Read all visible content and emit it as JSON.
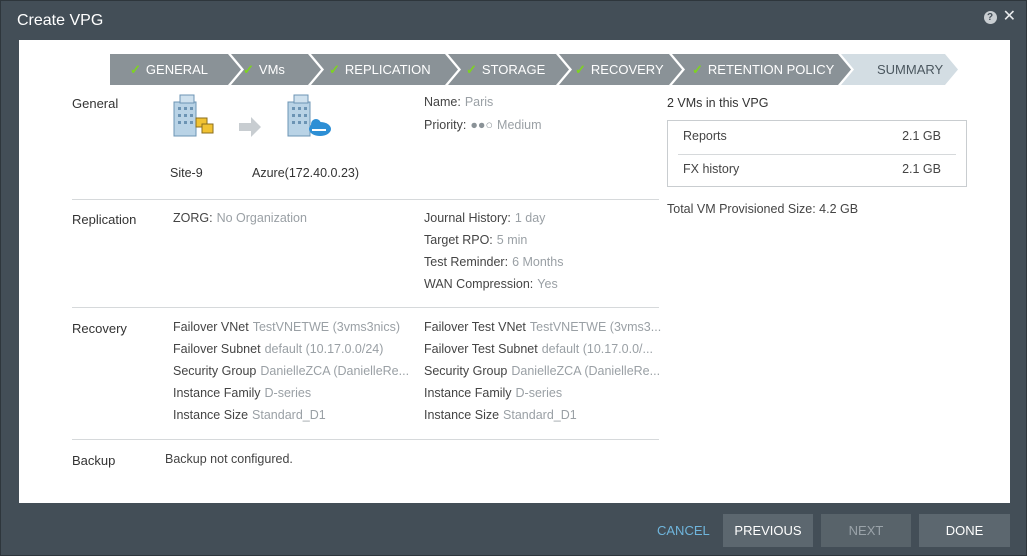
{
  "dialog": {
    "title": "Create VPG"
  },
  "steps": [
    {
      "label": "GENERAL",
      "done": true
    },
    {
      "label": "VMs",
      "done": true
    },
    {
      "label": "REPLICATION",
      "done": true
    },
    {
      "label": "STORAGE",
      "done": true
    },
    {
      "label": "RECOVERY",
      "done": true
    },
    {
      "label": "RETENTION POLICY",
      "done": true
    },
    {
      "label": "SUMMARY",
      "done": false
    }
  ],
  "general": {
    "section": "General",
    "source_site": "Site-9",
    "target_site": "Azure(172.40.0.23)",
    "name_label": "Name:",
    "name_value": "Paris",
    "priority_label": "Priority:",
    "priority_dots": "●●○",
    "priority_value": "Medium"
  },
  "replication": {
    "section": "Replication",
    "zorg_label": "ZORG:",
    "zorg_value": "No Organization",
    "journal_label": "Journal History:",
    "journal_value": "1 day",
    "rpo_label": "Target RPO:",
    "rpo_value": "5 min",
    "reminder_label": "Test Reminder:",
    "reminder_value": "6 Months",
    "wan_label": "WAN Compression:",
    "wan_value": "Yes"
  },
  "recovery": {
    "section": "Recovery",
    "left": [
      {
        "label": "Failover VNet",
        "value": "TestVNETWE (3vms3nics)"
      },
      {
        "label": "Failover Subnet",
        "value": "default (10.17.0.0/24)"
      },
      {
        "label": "Security Group",
        "value": "DanielleZCA (DanielleRe..."
      },
      {
        "label": "Instance Family",
        "value": "D-series"
      },
      {
        "label": "Instance Size",
        "value": "Standard_D1"
      }
    ],
    "right": [
      {
        "label": "Failover Test VNet",
        "value": "TestVNETWE (3vms3..."
      },
      {
        "label": "Failover Test Subnet",
        "value": "default (10.17.0.0/..."
      },
      {
        "label": "Security Group",
        "value": "DanielleZCA (DanielleRe..."
      },
      {
        "label": "Instance Family",
        "value": "D-series"
      },
      {
        "label": "Instance Size",
        "value": "Standard_D1"
      }
    ]
  },
  "backup": {
    "section": "Backup",
    "value": "Backup not configured."
  },
  "vms": {
    "heading": "2 VMs in this VPG",
    "items": [
      {
        "name": "Reports",
        "size": "2.1 GB"
      },
      {
        "name": "FX history",
        "size": "2.1 GB"
      }
    ],
    "total": "Total VM Provisioned Size: 4.2 GB"
  },
  "footer": {
    "cancel": "CANCEL",
    "previous": "PREVIOUS",
    "next": "NEXT",
    "done": "DONE"
  },
  "colors": {
    "accent_check": "#7ed321",
    "step_active": "#d3dde3",
    "step_done": "#8a9297",
    "link": "#6fb5dc"
  }
}
